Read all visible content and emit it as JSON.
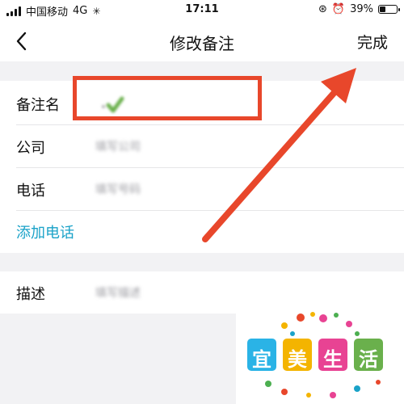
{
  "status_bar": {
    "carrier": "中国移动",
    "network": "4G",
    "time": "17:11",
    "battery_percent": "39%",
    "battery_level": 0.39
  },
  "nav": {
    "title": "修改备注",
    "done_label": "完成"
  },
  "form": {
    "remark": {
      "label": "备注名",
      "value": ""
    },
    "company": {
      "label": "公司",
      "placeholder": "填写公司"
    },
    "phone": {
      "label": "电话",
      "placeholder": "填写号码"
    },
    "add_phone_label": "添加电话",
    "description": {
      "label": "描述",
      "placeholder": "填写描述"
    }
  },
  "watermark": {
    "text": "宜美生活"
  },
  "colors": {
    "accent_link": "#1aa2c8",
    "annotation_red": "#e8472b",
    "background": "#f2f2f4"
  }
}
